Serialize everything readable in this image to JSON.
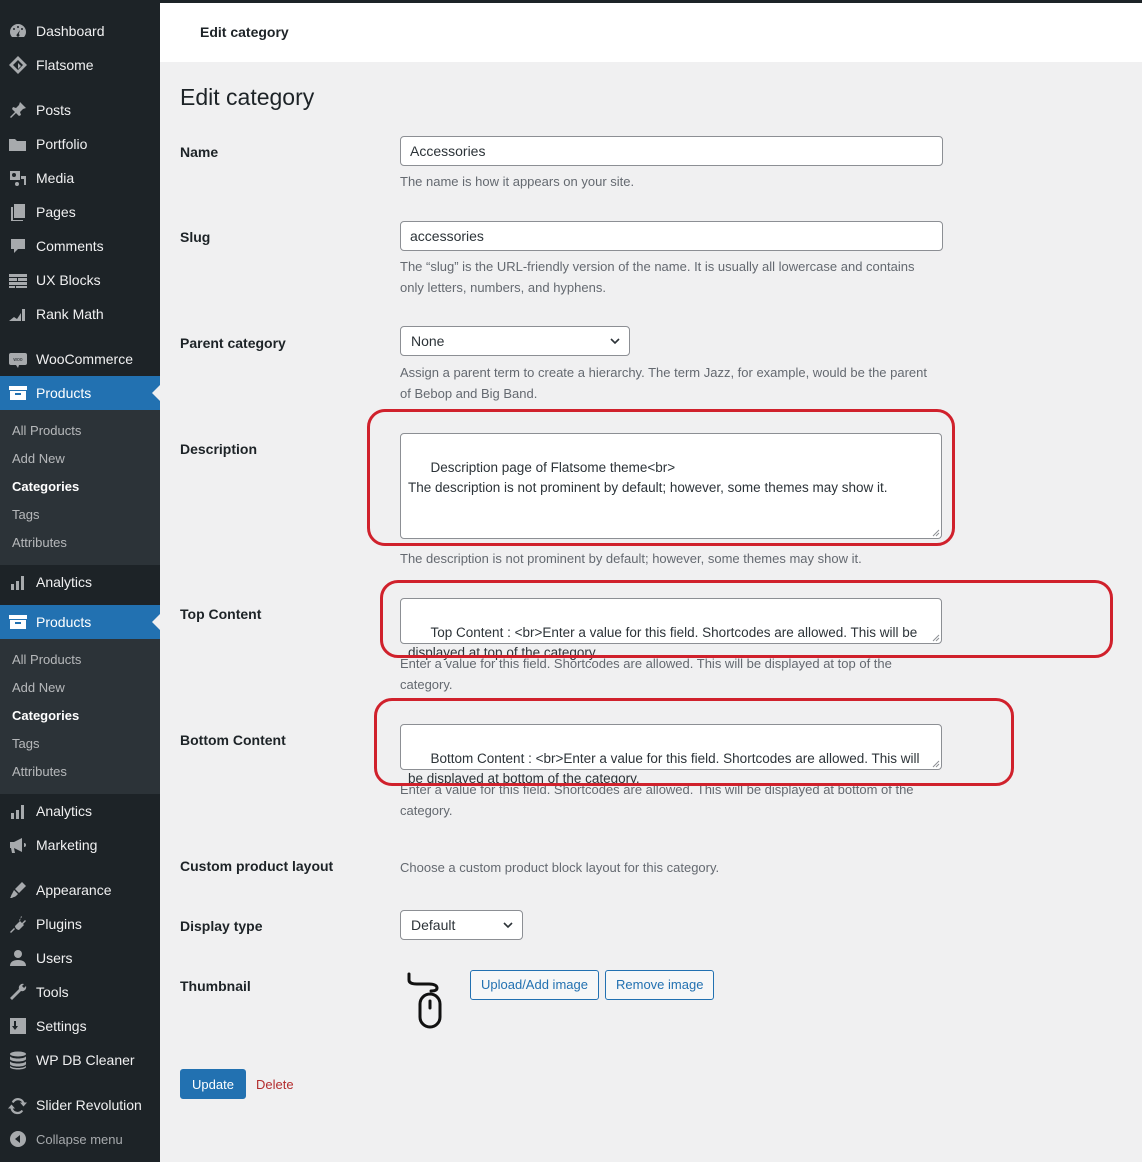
{
  "sidebar": {
    "items": [
      {
        "label": "Dashboard",
        "icon": "dashboard-icon"
      },
      {
        "label": "Flatsome",
        "icon": "flatsome-icon"
      },
      {
        "label": "Posts",
        "icon": "pin-icon"
      },
      {
        "label": "Portfolio",
        "icon": "folder-icon"
      },
      {
        "label": "Media",
        "icon": "media-icon"
      },
      {
        "label": "Pages",
        "icon": "pages-icon"
      },
      {
        "label": "Comments",
        "icon": "comment-icon"
      },
      {
        "label": "UX Blocks",
        "icon": "blocks-icon"
      },
      {
        "label": "Rank Math",
        "icon": "rank-math-icon"
      },
      {
        "label": "WooCommerce",
        "icon": "woo-icon"
      },
      {
        "label": "Products",
        "icon": "archive-icon"
      },
      {
        "label": "Analytics",
        "icon": "bar-chart-icon"
      },
      {
        "label": "Products",
        "icon": "archive-icon"
      },
      {
        "label": "Analytics",
        "icon": "bar-chart-icon"
      },
      {
        "label": "Marketing",
        "icon": "megaphone-icon"
      },
      {
        "label": "Appearance",
        "icon": "brush-icon"
      },
      {
        "label": "Plugins",
        "icon": "plugin-icon"
      },
      {
        "label": "Users",
        "icon": "user-icon"
      },
      {
        "label": "Tools",
        "icon": "wrench-icon"
      },
      {
        "label": "Settings",
        "icon": "settings-icon"
      },
      {
        "label": "WP DB Cleaner",
        "icon": "database-icon"
      },
      {
        "label": "Slider Revolution",
        "icon": "refresh-icon"
      },
      {
        "label": "Collapse menu",
        "icon": "collapse-icon"
      }
    ],
    "products_submenu": [
      "All Products",
      "Add New",
      "Categories",
      "Tags",
      "Attributes"
    ],
    "woo_badge": "woo"
  },
  "header": {
    "title": "Edit category"
  },
  "page": {
    "title": "Edit category",
    "name": {
      "label": "Name",
      "value": "Accessories",
      "help": "The name is how it appears on your site."
    },
    "slug": {
      "label": "Slug",
      "value": "accessories",
      "help": "The “slug” is the URL-friendly version of the name. It is usually all lowercase and contains only letters, numbers, and hyphens."
    },
    "parent": {
      "label": "Parent category",
      "value": "None",
      "help": "Assign a parent term to create a hierarchy. The term Jazz, for example, would be the parent of Bebop and Big Band."
    },
    "description": {
      "label": "Description",
      "value": "Description page of Flatsome theme<br>\nThe description is not prominent by default; however, some themes may show it.",
      "help": "The description is not prominent by default; however, some themes may show it."
    },
    "top_content": {
      "label": "Top Content",
      "value": "Top Content : <br>Enter a value for this field. Shortcodes are allowed. This will be displayed at top of the category.",
      "help": "Enter a value for this field. Shortcodes are allowed. This will be displayed at top of the category."
    },
    "bottom_content": {
      "label": "Bottom Content",
      "value": "Bottom Content : <br>Enter a value for this field. Shortcodes are allowed. This will be displayed at bottom of the category.",
      "help": "Enter a value for this field. Shortcodes are allowed. This will be displayed at bottom of the category."
    },
    "custom_layout": {
      "label": "Custom product layout",
      "help": "Choose a custom product block layout for this category."
    },
    "display_type": {
      "label": "Display type",
      "value": "Default"
    },
    "thumbnail": {
      "label": "Thumbnail",
      "upload_label": "Upload/Add image",
      "remove_label": "Remove image"
    },
    "update_label": "Update",
    "delete_label": "Delete"
  },
  "colors": {
    "accent": "#2271b1",
    "highlight": "#d0212c",
    "sidebar": "#1d2327",
    "delete": "#b32d2e"
  }
}
